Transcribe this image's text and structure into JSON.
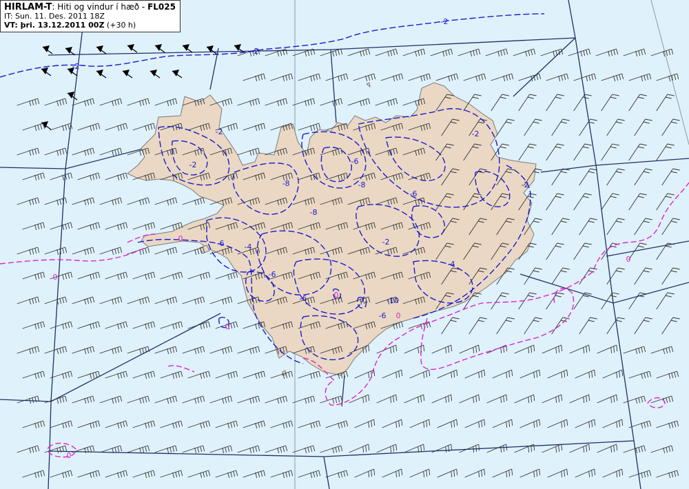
{
  "header": {
    "model": "HIRLAM-T",
    "description": ": Hiti og vindur í hæð - ",
    "level": "FL025",
    "initial_time": "IT: Sun. 11. Des. 2011 18Z",
    "valid_prefix": "VT:",
    "valid_time": " þri. 13.12.2011 00Z",
    "valid_offset": " (+30 h)"
  },
  "map": {
    "colors": {
      "sea": "#dff1fb",
      "land": "#ead8c4",
      "coastline": "#7a7a7a",
      "graticule": "#1f2f66",
      "negative_isotherm": "#1a1acc",
      "zero_isotherm": "#dd22cc",
      "wind_barb": "#333333",
      "strong_wind_flag": "#000000"
    },
    "isotherm_labels": [
      {
        "text": "-2",
        "color": "negative"
      },
      {
        "text": "-2",
        "color": "negative"
      },
      {
        "text": "-2",
        "color": "negative"
      },
      {
        "text": "-2",
        "color": "negative"
      },
      {
        "text": "-2",
        "color": "negative"
      },
      {
        "text": "-2",
        "color": "negative"
      },
      {
        "text": "-2",
        "color": "negative"
      },
      {
        "text": "-2",
        "color": "negative"
      },
      {
        "text": "-6",
        "color": "negative"
      },
      {
        "text": "-6",
        "color": "negative"
      },
      {
        "text": "-6",
        "color": "negative"
      },
      {
        "text": "-6",
        "color": "negative"
      },
      {
        "text": "-6",
        "color": "negative"
      },
      {
        "text": "-6",
        "color": "negative"
      },
      {
        "text": "-8",
        "color": "negative"
      },
      {
        "text": "-8",
        "color": "negative"
      },
      {
        "text": "-8",
        "color": "negative"
      },
      {
        "text": "-10",
        "color": "negative"
      },
      {
        "text": "-4",
        "color": "negative"
      },
      {
        "text": "-4",
        "color": "negative"
      },
      {
        "text": "0",
        "color": "zero"
      },
      {
        "text": "0",
        "color": "zero"
      },
      {
        "text": "0",
        "color": "zero"
      },
      {
        "text": "0",
        "color": "zero"
      },
      {
        "text": "0",
        "color": "zero"
      },
      {
        "text": "0",
        "color": "zero"
      },
      {
        "text": "0",
        "color": "zero"
      }
    ]
  }
}
